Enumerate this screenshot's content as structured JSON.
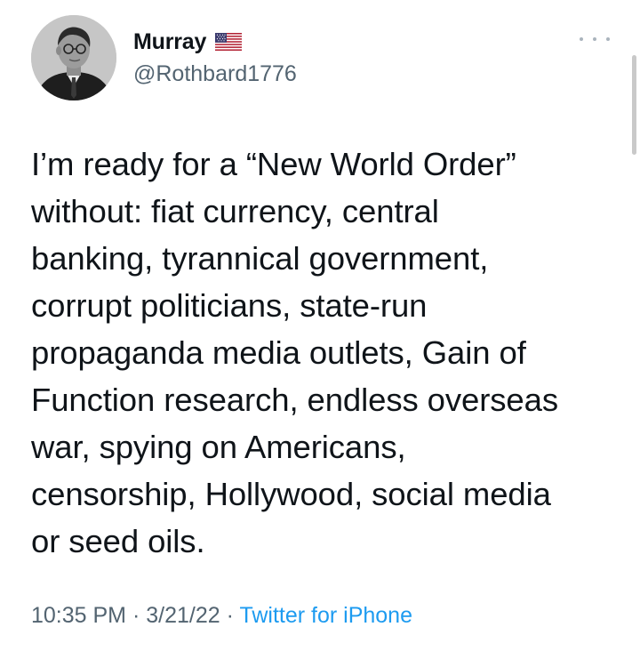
{
  "author": {
    "display_name": "Murray",
    "flag_icon": "us-flag-icon",
    "handle": "@Rothbard1776"
  },
  "menu": {
    "icon": "more-horizontal-icon"
  },
  "tweet": {
    "lines": [
      "I’m ready for a “New World Order”",
      "without: fiat currency, central",
      "banking, tyrannical government,",
      "corrupt politicians, state-run",
      "propaganda media outlets, Gain of",
      "Function research, endless overseas",
      "war, spying on Americans,",
      "censorship, Hollywood, social media",
      "or seed oils."
    ]
  },
  "meta": {
    "time": "10:35 PM",
    "separator": "·",
    "date": "3/21/22",
    "source": "Twitter for iPhone"
  },
  "colors": {
    "text": "#0f1419",
    "secondary": "#536471",
    "link": "#1d9bf0"
  }
}
